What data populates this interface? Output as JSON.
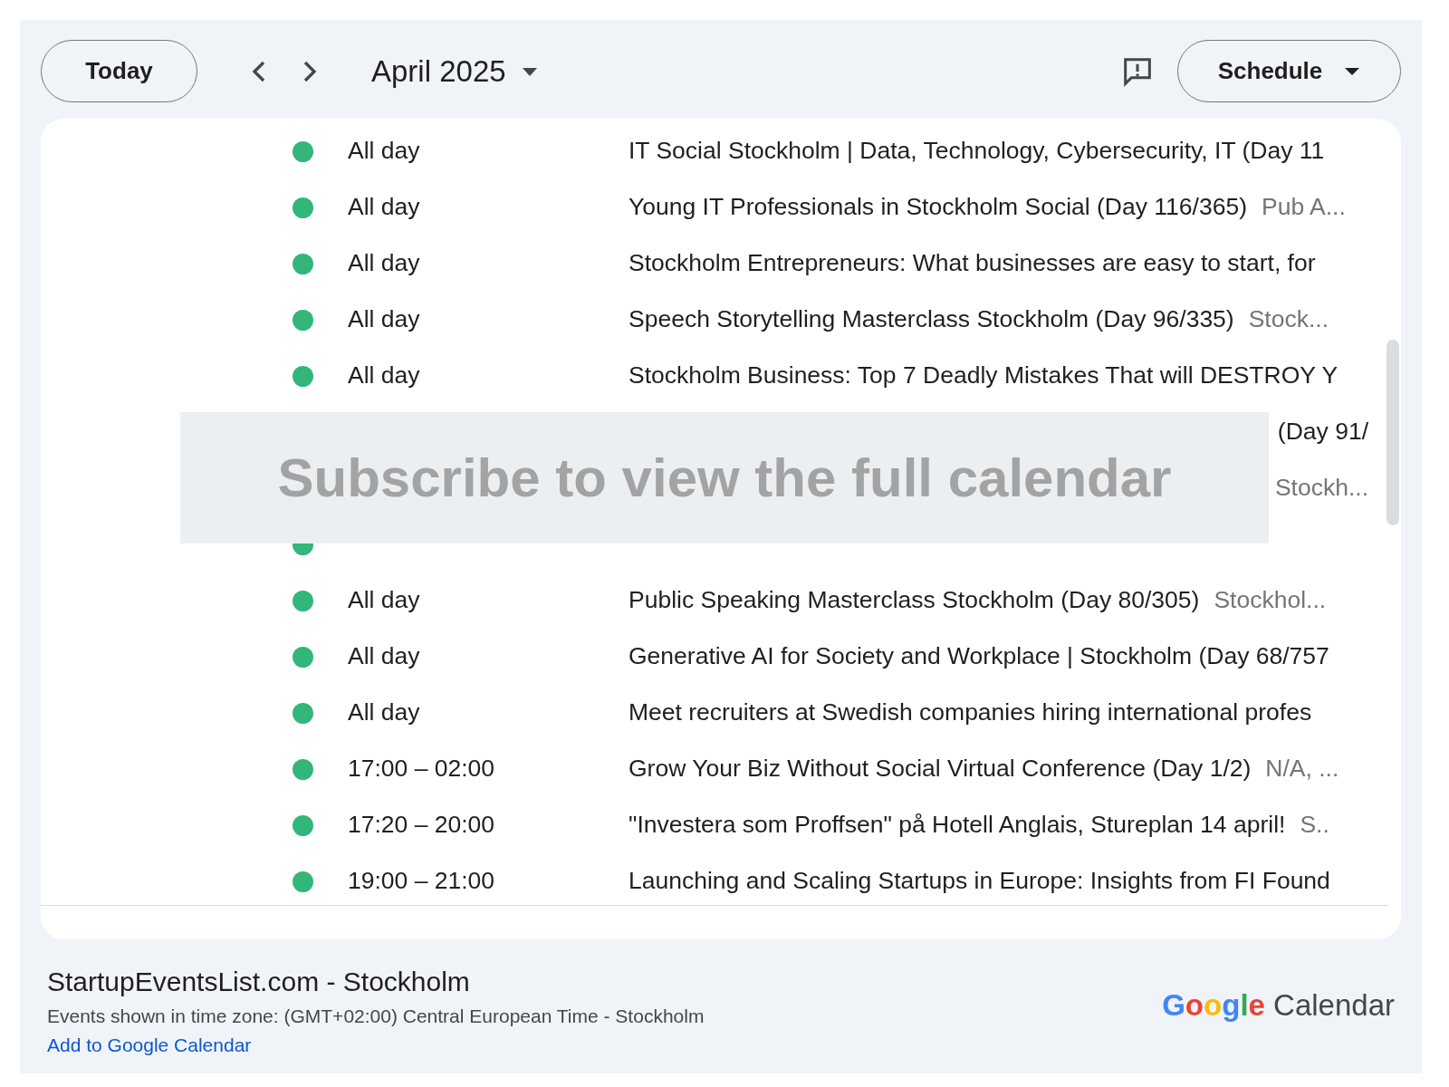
{
  "header": {
    "today_button": "Today",
    "title": "April 2025",
    "view_button": "Schedule"
  },
  "events": [
    {
      "kind": "event",
      "time": "All day",
      "title": "IT Social Stockholm | Data, Technology, Cybersecurity, IT (Day 11"
    },
    {
      "kind": "event",
      "time": "All day",
      "title": "Young IT Professionals in Stockholm Social (Day 116/365)",
      "location": "Pub A..."
    },
    {
      "kind": "event",
      "time": "All day",
      "title": "Stockholm Entrepreneurs: What businesses are easy to start, for"
    },
    {
      "kind": "event",
      "time": "All day",
      "title": "Speech Storytelling Masterclass Stockholm (Day 96/335)",
      "location": "Stock..."
    },
    {
      "kind": "event",
      "time": "All day",
      "title": "Stockholm Business: Top 7 Deadly Mistakes That will DESTROY Y"
    },
    {
      "kind": "covered",
      "title": "(Day 91/"
    },
    {
      "kind": "covered",
      "location": "Stockh..."
    },
    {
      "kind": "cut"
    },
    {
      "kind": "event",
      "time": "All day",
      "title": "Public Speaking Masterclass Stockholm (Day 80/305)",
      "location": "Stockhol..."
    },
    {
      "kind": "event",
      "time": "All day",
      "title": "Generative AI for Society and Workplace | Stockholm (Day 68/757"
    },
    {
      "kind": "event",
      "time": "All day",
      "title": "Meet recruiters at Swedish companies hiring international profes"
    },
    {
      "kind": "event",
      "time": "17:00 – 02:00",
      "title": "Grow Your Biz Without Social Virtual Conference (Day 1/2)",
      "location": "N/A, ..."
    },
    {
      "kind": "event",
      "time": "17:20 – 20:00",
      "title": "\"Investera som Proffsen\" på Hotell Anglais, Stureplan 14 april!",
      "location": "S.."
    },
    {
      "kind": "event",
      "time": "19:00 – 21:00",
      "title": "Launching and Scaling Startups in Europe: Insights from FI Found"
    }
  ],
  "overlay": {
    "text": "Subscribe to view the full calendar"
  },
  "footer": {
    "calendar_name": "StartupEventsList.com - Stockholm",
    "timezone": "Events shown in time zone: (GMT+02:00) Central European Time - Stockholm",
    "link": "Add to Google Calendar",
    "logo_word": "Google",
    "logo_product": "Calendar"
  }
}
